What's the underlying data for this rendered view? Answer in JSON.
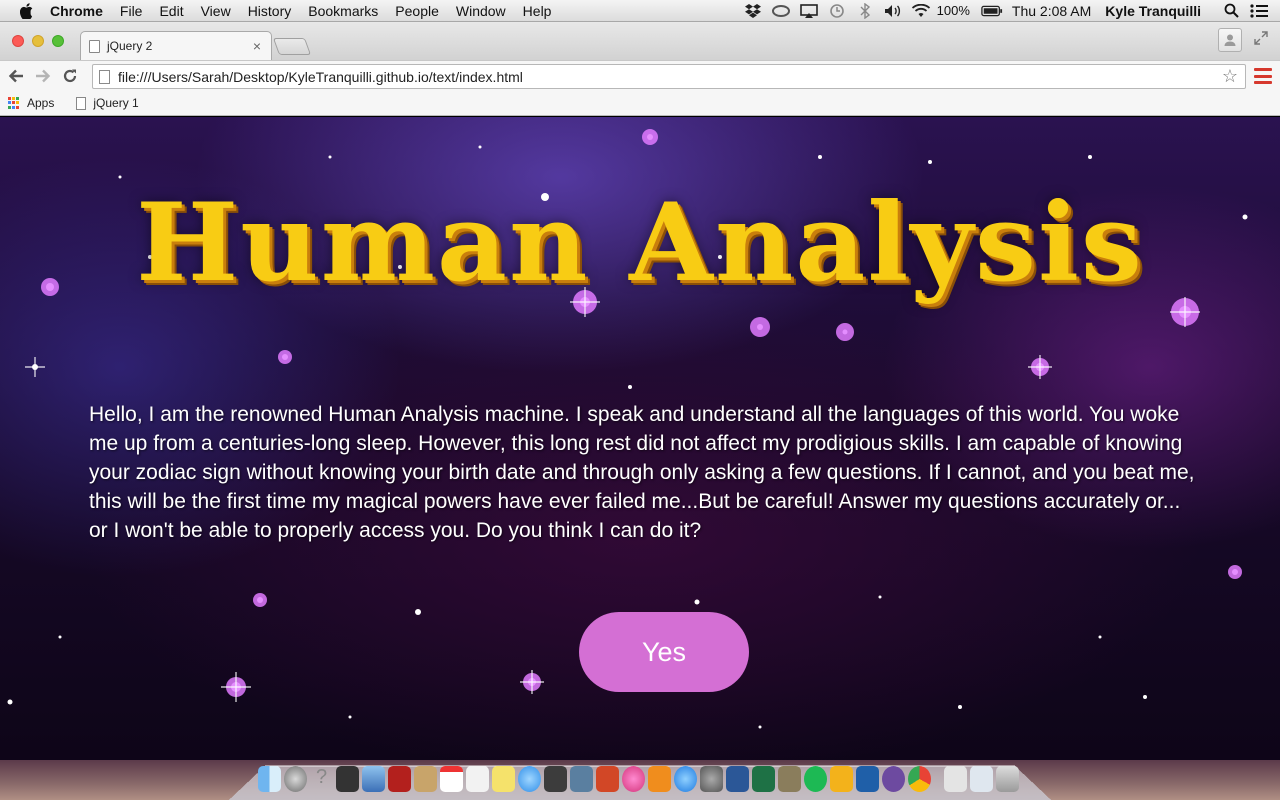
{
  "menubar": {
    "app_name": "Chrome",
    "items": [
      "File",
      "Edit",
      "View",
      "History",
      "Bookmarks",
      "People",
      "Window",
      "Help"
    ],
    "battery": "100%",
    "clock": "Thu 2:08 AM",
    "user": "Kyle Tranquilli",
    "tray_icons": [
      "dropbox-icon",
      "creative-cloud-icon",
      "airplay-icon",
      "time-machine-icon",
      "bluetooth-icon",
      "volume-icon",
      "wifi-icon",
      "battery-icon"
    ]
  },
  "browser": {
    "tab": {
      "title": "jQuery 2",
      "close": "×"
    },
    "url": "file:///Users/Sarah/Desktop/KyleTranquilli.github.io/text/index.html",
    "bookmarks": [
      {
        "label": "Apps",
        "icon": "apps-grid-icon"
      },
      {
        "label": "jQuery 1",
        "icon": "page-icon"
      }
    ]
  },
  "page": {
    "heading": "Human Analysis",
    "intro": "Hello, I am the renowned Human Analysis machine. I speak and understand all the languages of this world. You woke me up from a centuries-long sleep. However, this long rest did not affect my prodigious skills. I am capable of knowing your zodiac sign without knowing your birth date and through only asking a few questions. If I cannot, and you beat me, this will be the first time my magical powers have ever failed me...But be careful! Answer my questions accurately or... or I won't be able to properly access you. Do you think I can do it?",
    "button": "Yes"
  },
  "colors": {
    "heading": "#f8cc14",
    "heading_shadow": "#c97f0c",
    "button": "#d46fd4",
    "text": "#ffffff"
  },
  "dock": {
    "icons": [
      "finder-icon",
      "launchpad-icon",
      "help-icon",
      "terminal-icon",
      "preview-icon",
      "photo-booth-icon",
      "contacts-icon",
      "calendar-icon",
      "textedit-icon",
      "stickies-icon",
      "messages-icon",
      "facetime-icon",
      "photos-icon",
      "powerpoint-icon",
      "itunes-icon",
      "ibooks-icon",
      "app-store-icon",
      "system-preferences-icon",
      "word-icon",
      "excel-icon",
      "gimp-icon",
      "spotify-icon",
      "outlook-icon",
      "unknown-app-icon",
      "github-icon",
      "chrome-icon",
      "documents-folder-icon",
      "downloads-folder-icon",
      "trash-icon"
    ]
  }
}
